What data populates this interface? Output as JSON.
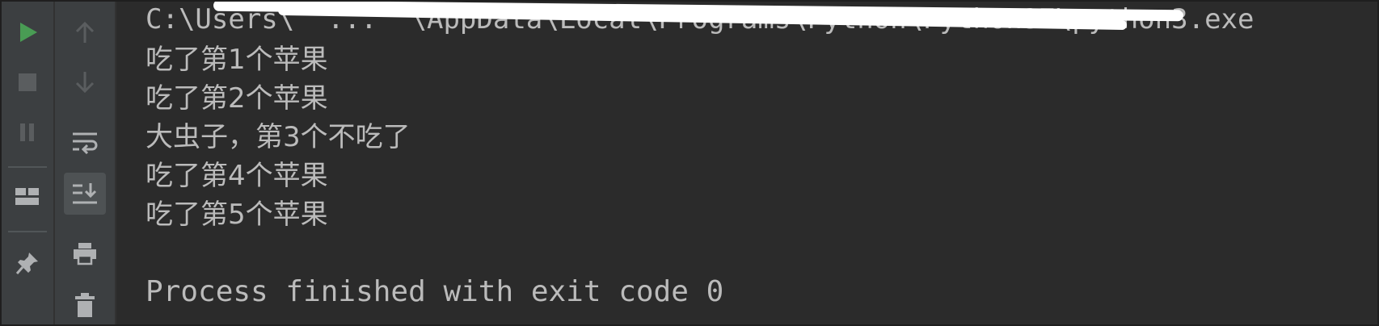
{
  "toolbar_left": {
    "run": {
      "icon": "run-icon",
      "color": "#499c54"
    },
    "stop": {
      "icon": "stop-icon"
    },
    "pause": {
      "icon": "pause-icon"
    },
    "layout": {
      "icon": "layout-icon"
    },
    "pin": {
      "icon": "pin-icon"
    }
  },
  "toolbar_right": {
    "up": {
      "icon": "arrow-up-icon"
    },
    "down": {
      "icon": "arrow-down-icon"
    },
    "wrap": {
      "icon": "soft-wrap-icon"
    },
    "scroll_end": {
      "icon": "scroll-to-end-icon"
    },
    "print": {
      "icon": "print-icon"
    },
    "trash": {
      "icon": "trash-icon"
    }
  },
  "console": {
    "command": "C:\\Users\\  ...  \\AppData\\Local\\Programs\\Python\\Python37\\python3.exe",
    "lines": [
      "吃了第1个苹果",
      "吃了第2个苹果",
      "大虫子，第3个不吃了",
      "吃了第4个苹果",
      "吃了第5个苹果",
      "",
      "Process finished with exit code 0"
    ]
  },
  "colors": {
    "console_bg": "#2b2b2b",
    "toolbar_bg": "#3c3f41",
    "text": "#bbbbbb",
    "run_green": "#499c54",
    "icon_gray": "#afb1b3"
  }
}
